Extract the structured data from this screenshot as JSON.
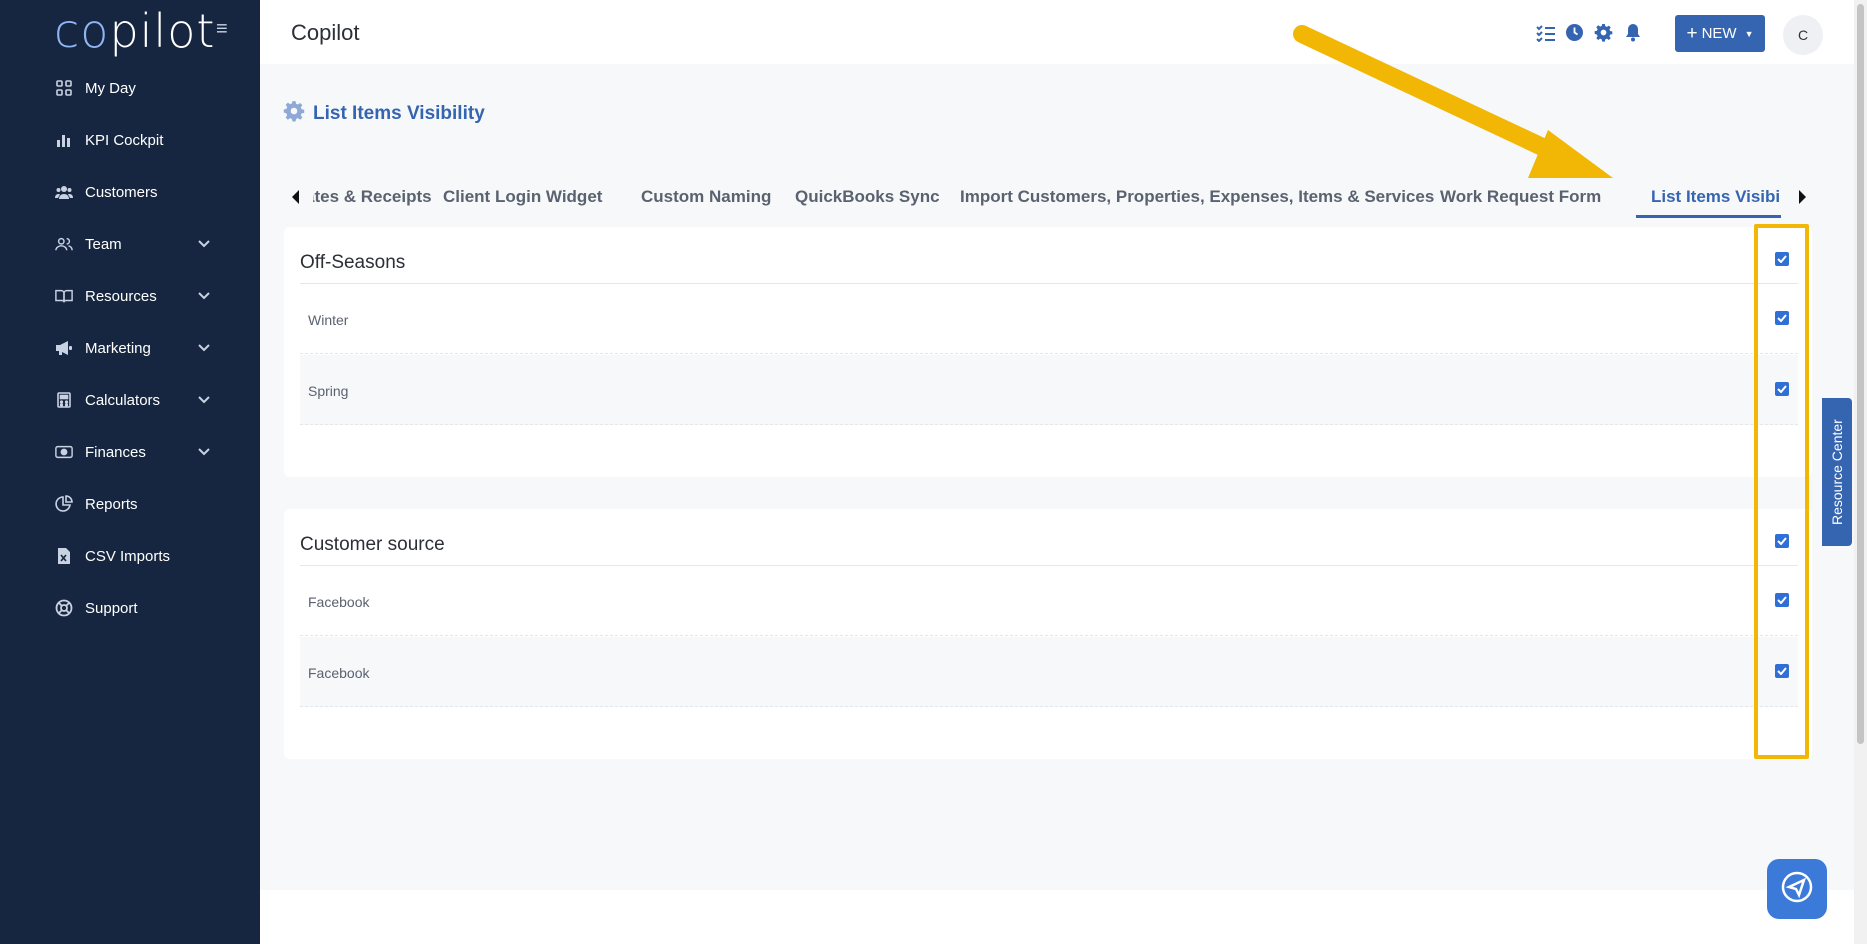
{
  "sidebar": {
    "logo_prefix": "co",
    "logo_suffix": "pilot",
    "items": [
      {
        "label": "My Day",
        "icon": "grid-icon",
        "expandable": false
      },
      {
        "label": "KPI Cockpit",
        "icon": "bar-chart-icon",
        "expandable": false
      },
      {
        "label": "Customers",
        "icon": "users-icon",
        "expandable": false
      },
      {
        "label": "Team",
        "icon": "team-icon",
        "expandable": true
      },
      {
        "label": "Resources",
        "icon": "book-icon",
        "expandable": true
      },
      {
        "label": "Marketing",
        "icon": "megaphone-icon",
        "expandable": true
      },
      {
        "label": "Calculators",
        "icon": "calculator-icon",
        "expandable": true
      },
      {
        "label": "Finances",
        "icon": "money-icon",
        "expandable": true
      },
      {
        "label": "Reports",
        "icon": "pie-chart-icon",
        "expandable": false
      },
      {
        "label": "CSV Imports",
        "icon": "csv-file-icon",
        "expandable": false
      },
      {
        "label": "Support",
        "icon": "lifebuoy-icon",
        "expandable": false
      }
    ]
  },
  "header": {
    "title": "Copilot",
    "new_label": "NEW",
    "avatar_initial": "C",
    "icons": [
      "checklist-icon",
      "clock-icon",
      "gear-icon",
      "bell-icon"
    ]
  },
  "page": {
    "heading": "List Items Visibility",
    "tabs": [
      {
        "label": "ates & Receipts",
        "active": false
      },
      {
        "label": "Client Login Widget",
        "active": false
      },
      {
        "label": "Custom Naming",
        "active": false
      },
      {
        "label": "QuickBooks Sync",
        "active": false
      },
      {
        "label": "Import Customers, Properties, Expenses, Items & Services",
        "active": false
      },
      {
        "label": "Work Request Form",
        "active": false
      },
      {
        "label": "List Items Visibility",
        "active": true
      }
    ],
    "sections": [
      {
        "title": "Off-Seasons",
        "checked": true,
        "items": [
          {
            "label": "Winter",
            "checked": true
          },
          {
            "label": "Spring",
            "checked": true
          }
        ]
      },
      {
        "title": "Customer source",
        "checked": true,
        "items": [
          {
            "label": "Facebook",
            "checked": true
          },
          {
            "label": "Facebook",
            "checked": true
          }
        ]
      }
    ]
  },
  "resource_center": "Resource Center",
  "colors": {
    "sidebar": "#172640",
    "accent": "#3565b0",
    "highlight": "#f2b705"
  }
}
